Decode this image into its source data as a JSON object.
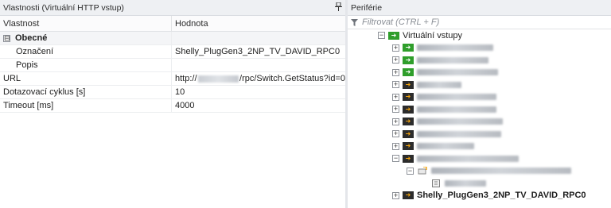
{
  "left_pane": {
    "title": "Vlastnosti (Virtuální HTTP vstup)",
    "pin_icon": "pin-icon",
    "columns": {
      "name": "Vlastnost",
      "value": "Hodnota"
    },
    "category": {
      "label": "Obecné",
      "toggle": "⊟"
    },
    "rows": [
      {
        "name": "Označení",
        "value": "Shelly_PlugGen3_2NP_TV_DAVID_RPC0"
      },
      {
        "name": "Popis",
        "value": ""
      },
      {
        "name": "URL",
        "value_prefix": "http://",
        "value_suffix": "/rpc/Switch.GetStatus?id=0"
      },
      {
        "name": "Dotazovací cyklus [s]",
        "value": "10"
      },
      {
        "name": "Timeout [ms]",
        "value": "4000"
      }
    ]
  },
  "right_pane": {
    "title": "Periférie",
    "filter_placeholder": "Filtrovat (CTRL + F)",
    "tree_root": "Virtuální vstupy",
    "selected_item": "Shelly_PlugGen3_2NP_TV_DAVID_RPC0",
    "colors": {
      "green_node": "#2f9e2b",
      "dark_node": "#2c2c2c",
      "orange_arrow": "#f5a40c"
    }
  }
}
